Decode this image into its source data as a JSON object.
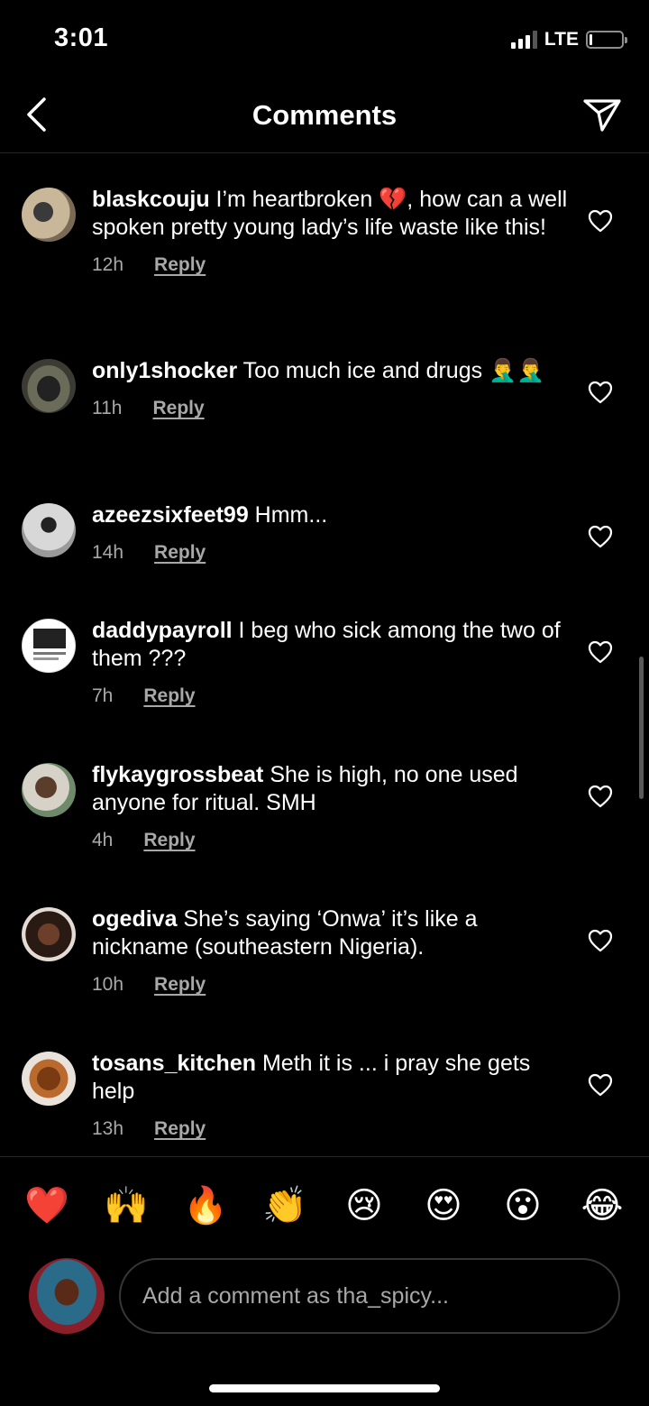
{
  "status": {
    "time": "3:01",
    "network": "LTE"
  },
  "header": {
    "title": "Comments"
  },
  "comments": [
    {
      "user": "blaskcouju",
      "text": " I’m heartbroken 💔, how can a well spoken pretty young lady’s life waste like this!",
      "time": "12h",
      "reply": "Reply"
    },
    {
      "user": "only1shocker",
      "text": " Too much ice and drugs 🤦‍♂️🤦‍♂️",
      "time": "11h",
      "reply": "Reply"
    },
    {
      "user": "azeezsixfeet99",
      "text": " Hmm...",
      "time": "14h",
      "reply": "Reply"
    },
    {
      "user": "daddypayroll",
      "text": " I beg who sick among the two of them ???",
      "time": "7h",
      "reply": "Reply"
    },
    {
      "user": "flykaygrossbeat",
      "text": " She is high, no one used anyone for ritual. SMH",
      "time": "4h",
      "reply": "Reply"
    },
    {
      "user": "ogediva",
      "text": " She’s saying ‘Onwa’ it’s like a nickname (southeastern Nigeria).",
      "time": "10h",
      "reply": "Reply"
    },
    {
      "user": "tosans_kitchen",
      "text": " Meth it is ... i pray she gets help",
      "time": "13h",
      "reply": "Reply"
    }
  ],
  "reactions": [
    "❤️",
    "🙌",
    "🔥",
    "👏",
    "😢",
    "😍",
    "😮",
    "😂"
  ],
  "composer": {
    "placeholder": "Add a comment as tha_spicy..."
  },
  "icons": {
    "back": "back-chevron-icon",
    "send": "send-icon",
    "like": "heart-icon"
  }
}
